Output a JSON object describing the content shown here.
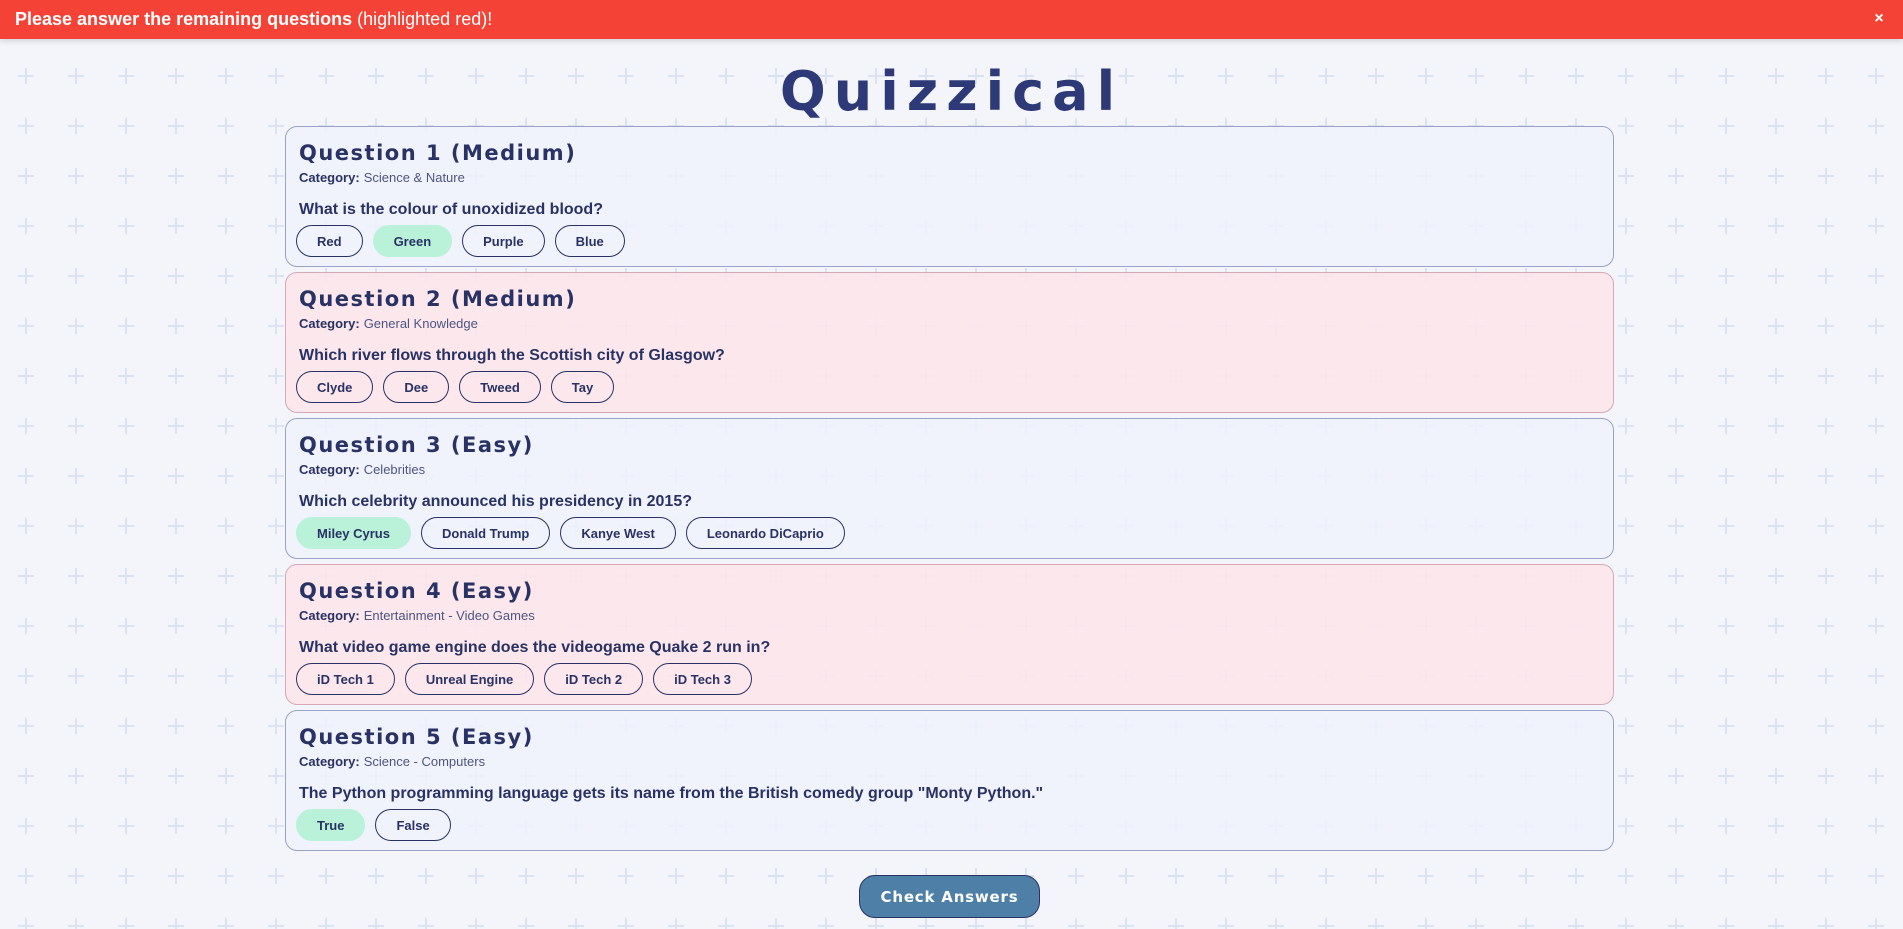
{
  "alert": {
    "strong": "Please answer the remaining questions",
    "rest": "(highlighted red)!",
    "close_glyph": "×"
  },
  "app": {
    "title": "Quizzical"
  },
  "questions": [
    {
      "heading": "Question 1 (Medium)",
      "category_label": "Category:",
      "category": "Science & Nature",
      "text": "What is the colour of unoxidized blood?",
      "unanswered": false,
      "answers": [
        {
          "label": "Red",
          "selected": false
        },
        {
          "label": "Green",
          "selected": true
        },
        {
          "label": "Purple",
          "selected": false
        },
        {
          "label": "Blue",
          "selected": false
        }
      ]
    },
    {
      "heading": "Question 2 (Medium)",
      "category_label": "Category:",
      "category": "General Knowledge",
      "text": "Which river flows through the Scottish city of Glasgow?",
      "unanswered": true,
      "answers": [
        {
          "label": "Clyde",
          "selected": false
        },
        {
          "label": "Dee",
          "selected": false
        },
        {
          "label": "Tweed",
          "selected": false
        },
        {
          "label": "Tay",
          "selected": false
        }
      ]
    },
    {
      "heading": "Question 3 (Easy)",
      "category_label": "Category:",
      "category": "Celebrities",
      "text": "Which celebrity announced his presidency in 2015?",
      "unanswered": false,
      "answers": [
        {
          "label": "Miley Cyrus",
          "selected": true
        },
        {
          "label": "Donald Trump",
          "selected": false
        },
        {
          "label": "Kanye West",
          "selected": false
        },
        {
          "label": "Leonardo DiCaprio",
          "selected": false
        }
      ]
    },
    {
      "heading": "Question 4 (Easy)",
      "category_label": "Category:",
      "category": "Entertainment - Video Games",
      "text": "What video game engine does the videogame Quake 2 run in?",
      "unanswered": true,
      "answers": [
        {
          "label": "iD Tech 1",
          "selected": false
        },
        {
          "label": "Unreal Engine",
          "selected": false
        },
        {
          "label": "iD Tech 2",
          "selected": false
        },
        {
          "label": "iD Tech 3",
          "selected": false
        }
      ]
    },
    {
      "heading": "Question 5 (Easy)",
      "category_label": "Category:",
      "category": "Science - Computers",
      "text": "The Python programming language gets its name from the British comedy group \"Monty Python.\"",
      "unanswered": false,
      "answers": [
        {
          "label": "True",
          "selected": true
        },
        {
          "label": "False",
          "selected": false
        }
      ]
    }
  ],
  "check_button": {
    "label": "Check Answers"
  },
  "colors": {
    "alert": "#f44336",
    "text": "#293264",
    "selected": "#b9f2d8",
    "unanswered": "#fce5ea",
    "button": "#4d7fa7",
    "background": "#f3f5fb"
  }
}
